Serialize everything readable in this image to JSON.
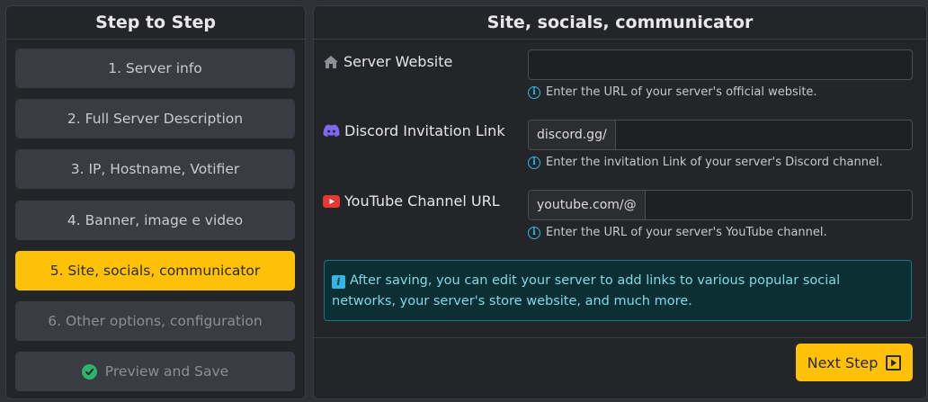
{
  "sidebar": {
    "title": "Step to Step",
    "steps": [
      {
        "label": "1. Server info"
      },
      {
        "label": "2. Full Server Description"
      },
      {
        "label": "3. IP, Hostname, Votifier"
      },
      {
        "label": "4. Banner, image e video"
      },
      {
        "label": "5. Site, socials, communicator"
      },
      {
        "label": "6. Other options, configuration"
      },
      {
        "label": "Preview and Save"
      }
    ]
  },
  "main": {
    "title": "Site, socials, communicator",
    "website": {
      "label": "Server Website",
      "value": "",
      "hint": "Enter the URL of your server's official website."
    },
    "discord": {
      "label": "Discord Invitation Link",
      "prefix": "discord.gg/",
      "value": "",
      "hint": "Enter the invitation Link of your server's Discord channel."
    },
    "youtube": {
      "label": "YouTube Channel URL",
      "prefix": "youtube.com/@",
      "value": "",
      "hint": "Enter the URL of your server's YouTube channel."
    },
    "alert": "After saving, you can edit your server to add links to various popular social networks, your server's store website, and much more.",
    "next_button": "Next Step"
  },
  "colors": {
    "accent": "#ffc107",
    "info": "#33b5e5",
    "success": "#2fb36b",
    "discord": "#5865f2",
    "youtube": "#e53935"
  }
}
